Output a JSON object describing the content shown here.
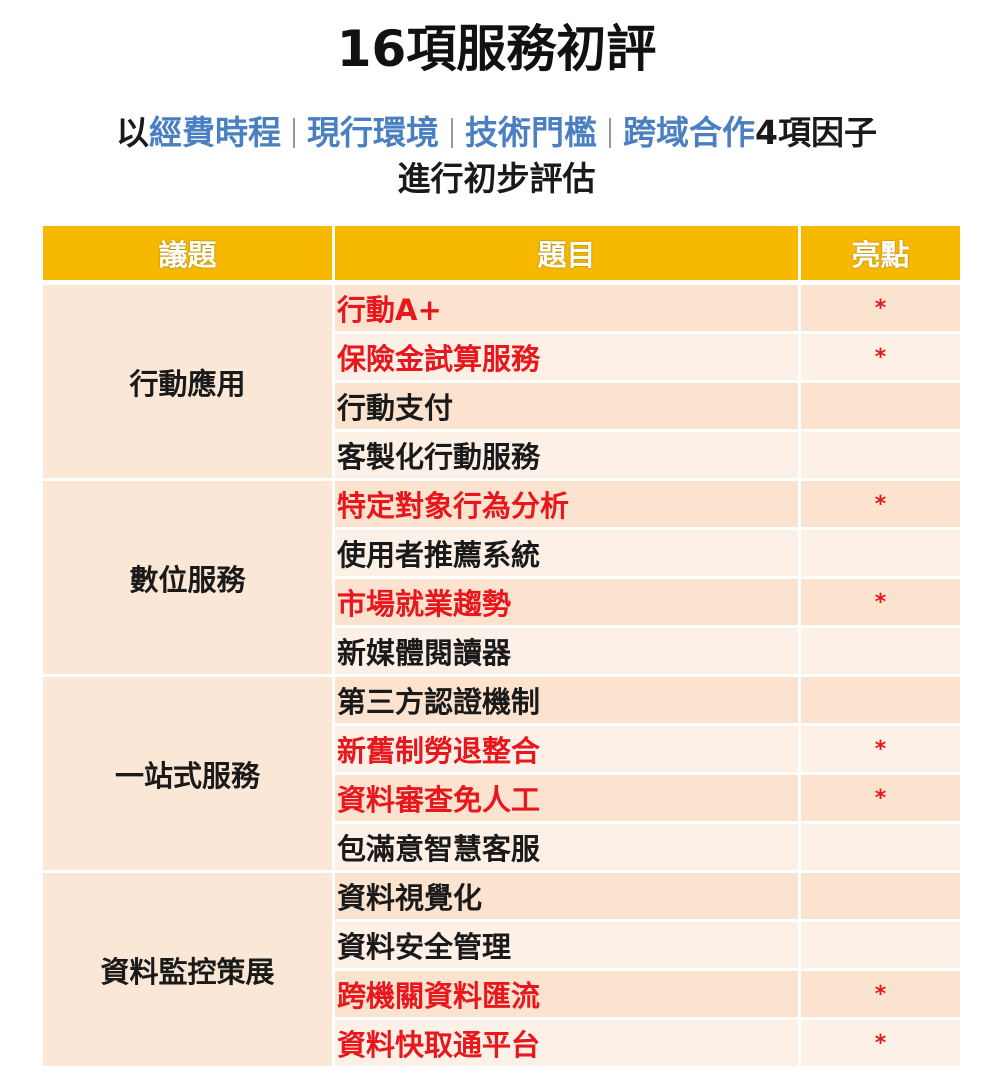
{
  "title": "16項服務初評",
  "subtitle": {
    "prefix": "以",
    "factors": [
      "經費時程",
      "現行環境",
      "技術門檻",
      "跨域合作"
    ],
    "suffix": "4項因子",
    "line2": "進行初步評估"
  },
  "table": {
    "headers": [
      "議題",
      "題目",
      "亮點"
    ],
    "star_symbol": "*",
    "groups": [
      {
        "issue": "行動應用",
        "items": [
          {
            "name": "行動A+",
            "highlight": true
          },
          {
            "name": "保險金試算服務",
            "highlight": true
          },
          {
            "name": "行動支付",
            "highlight": false
          },
          {
            "name": "客製化行動服務",
            "highlight": false
          }
        ]
      },
      {
        "issue": "數位服務",
        "items": [
          {
            "name": "特定對象行為分析",
            "highlight": true
          },
          {
            "name": "使用者推薦系統",
            "highlight": false
          },
          {
            "name": "市場就業趨勢",
            "highlight": true
          },
          {
            "name": "新媒體閱讀器",
            "highlight": false
          }
        ]
      },
      {
        "issue": "一站式服務",
        "items": [
          {
            "name": "第三方認證機制",
            "highlight": false
          },
          {
            "name": "新舊制勞退整合",
            "highlight": true
          },
          {
            "name": "資料審查免人工",
            "highlight": true
          },
          {
            "name": "包滿意智慧客服",
            "highlight": false
          }
        ]
      },
      {
        "issue": "資料監控策展",
        "items": [
          {
            "name": "資料視覺化",
            "highlight": false
          },
          {
            "name": "資料安全管理",
            "highlight": false
          },
          {
            "name": "跨機關資料匯流",
            "highlight": true
          },
          {
            "name": "資料快取通平台",
            "highlight": true
          }
        ]
      }
    ]
  },
  "colors": {
    "header_bg": "#f7b900",
    "factor_text": "#4a7fc1",
    "highlight_text": "#e8171d",
    "row_light": "#fdf0e6",
    "row_dark": "#fbe3cf"
  }
}
